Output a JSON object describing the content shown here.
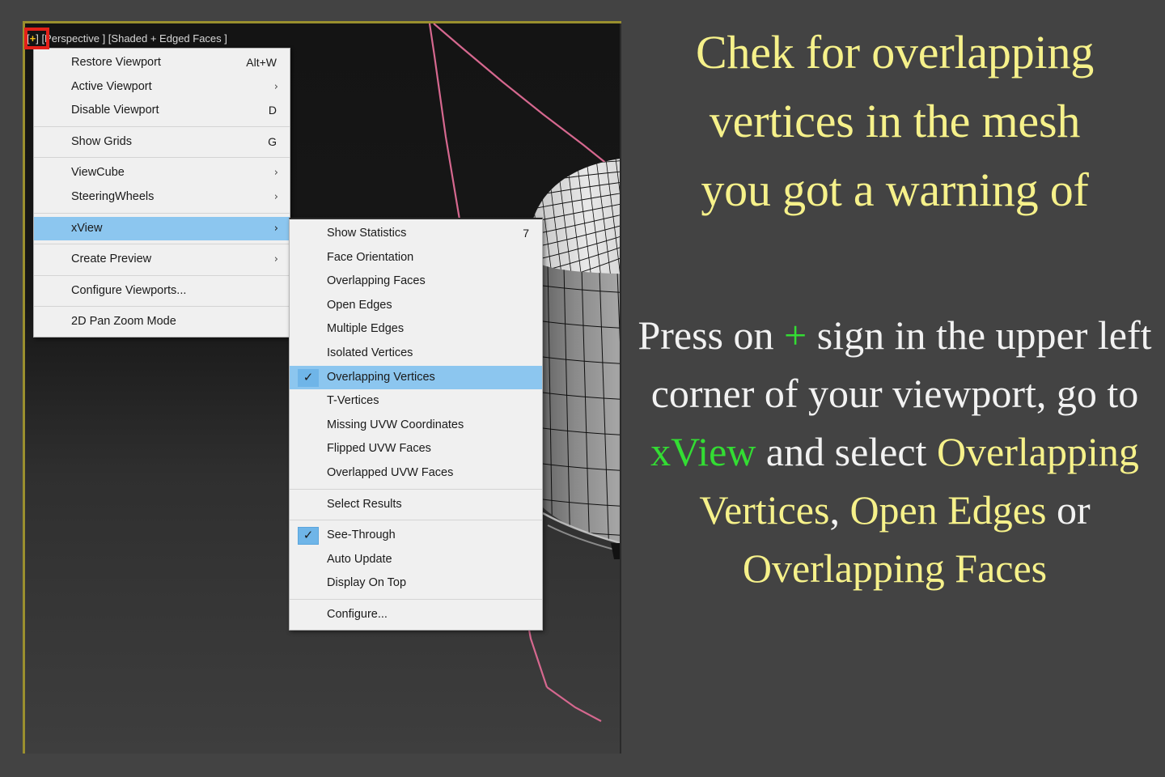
{
  "viewport": {
    "label_plus": "+",
    "label_brackets_left": "[",
    "label_brackets_right": "]",
    "label_full": "[+] [Perspective ] [Shaded + Edged Faces ]",
    "label_prefix": "[",
    "label_suffix": "] [Perspective ] [Shaded + Edged Faces ]",
    "border_color": "#9a8f2e",
    "selection_line_color": "#d6688f",
    "callout_color": "#e32119"
  },
  "menu_main": {
    "name": "viewport-config-menu",
    "items": [
      {
        "label": "Restore Viewport",
        "accel": "Alt+W",
        "type": "item"
      },
      {
        "label": "Active Viewport",
        "accel": "",
        "type": "submenu"
      },
      {
        "label": "Disable Viewport",
        "accel": "D",
        "type": "item"
      },
      {
        "type": "separator"
      },
      {
        "label": "Show Grids",
        "accel": "G",
        "type": "item"
      },
      {
        "type": "separator"
      },
      {
        "label": "ViewCube",
        "accel": "",
        "type": "submenu"
      },
      {
        "label": "SteeringWheels",
        "accel": "",
        "type": "submenu"
      },
      {
        "type": "separator"
      },
      {
        "label": "xView",
        "accel": "",
        "type": "submenu",
        "highlighted": true
      },
      {
        "type": "separator"
      },
      {
        "label": "Create Preview",
        "accel": "",
        "type": "submenu"
      },
      {
        "type": "separator"
      },
      {
        "label": "Configure Viewports...",
        "accel": "",
        "type": "item"
      },
      {
        "type": "separator"
      },
      {
        "label": "2D Pan Zoom Mode",
        "accel": "",
        "type": "item"
      }
    ]
  },
  "menu_sub": {
    "name": "xview-submenu",
    "items": [
      {
        "label": "Show Statistics",
        "accel": "7",
        "type": "item"
      },
      {
        "label": "Face Orientation",
        "accel": "",
        "type": "item"
      },
      {
        "label": "Overlapping Faces",
        "accel": "",
        "type": "item"
      },
      {
        "label": "Open Edges",
        "accel": "",
        "type": "item"
      },
      {
        "label": "Multiple Edges",
        "accel": "",
        "type": "item"
      },
      {
        "label": "Isolated Vertices",
        "accel": "",
        "type": "item"
      },
      {
        "label": "Overlapping Vertices",
        "accel": "",
        "type": "item",
        "checked": true,
        "highlighted": true
      },
      {
        "label": "T-Vertices",
        "accel": "",
        "type": "item"
      },
      {
        "label": "Missing UVW Coordinates",
        "accel": "",
        "type": "item"
      },
      {
        "label": "Flipped UVW Faces",
        "accel": "",
        "type": "item"
      },
      {
        "label": "Overlapped UVW Faces",
        "accel": "",
        "type": "item"
      },
      {
        "type": "separator"
      },
      {
        "label": "Select Results",
        "accel": "",
        "type": "item"
      },
      {
        "type": "separator"
      },
      {
        "label": "See-Through",
        "accel": "",
        "type": "item",
        "checked": true,
        "checkbox": true
      },
      {
        "label": "Auto Update",
        "accel": "",
        "type": "item"
      },
      {
        "label": "Display On Top",
        "accel": "",
        "type": "item"
      },
      {
        "type": "separator"
      },
      {
        "label": "Configure...",
        "accel": "",
        "type": "item"
      }
    ],
    "check_glyph": "✓",
    "chevron_glyph": "›"
  },
  "instructions": {
    "headline_line1": "Chek for overlapping",
    "headline_line2": "vertices in the mesh",
    "headline_line3": "you got a warning of",
    "body": {
      "seg1": "Press on ",
      "seg2_green": "+",
      "seg3": " sign in the upper left corner of your viewport, go to ",
      "seg4_green": "xView",
      "seg5": " and select ",
      "seg6_yellow": "Overlapping Vertices",
      "seg7": ", ",
      "seg8_yellow": "Open Edges",
      "seg9": " or ",
      "seg10_yellow": "Overlapping Faces"
    },
    "headline_color": "#f6f18a",
    "body_color": "#f2f2f2",
    "accent_green": "#33dd33",
    "accent_yellow": "#f6f18a"
  }
}
